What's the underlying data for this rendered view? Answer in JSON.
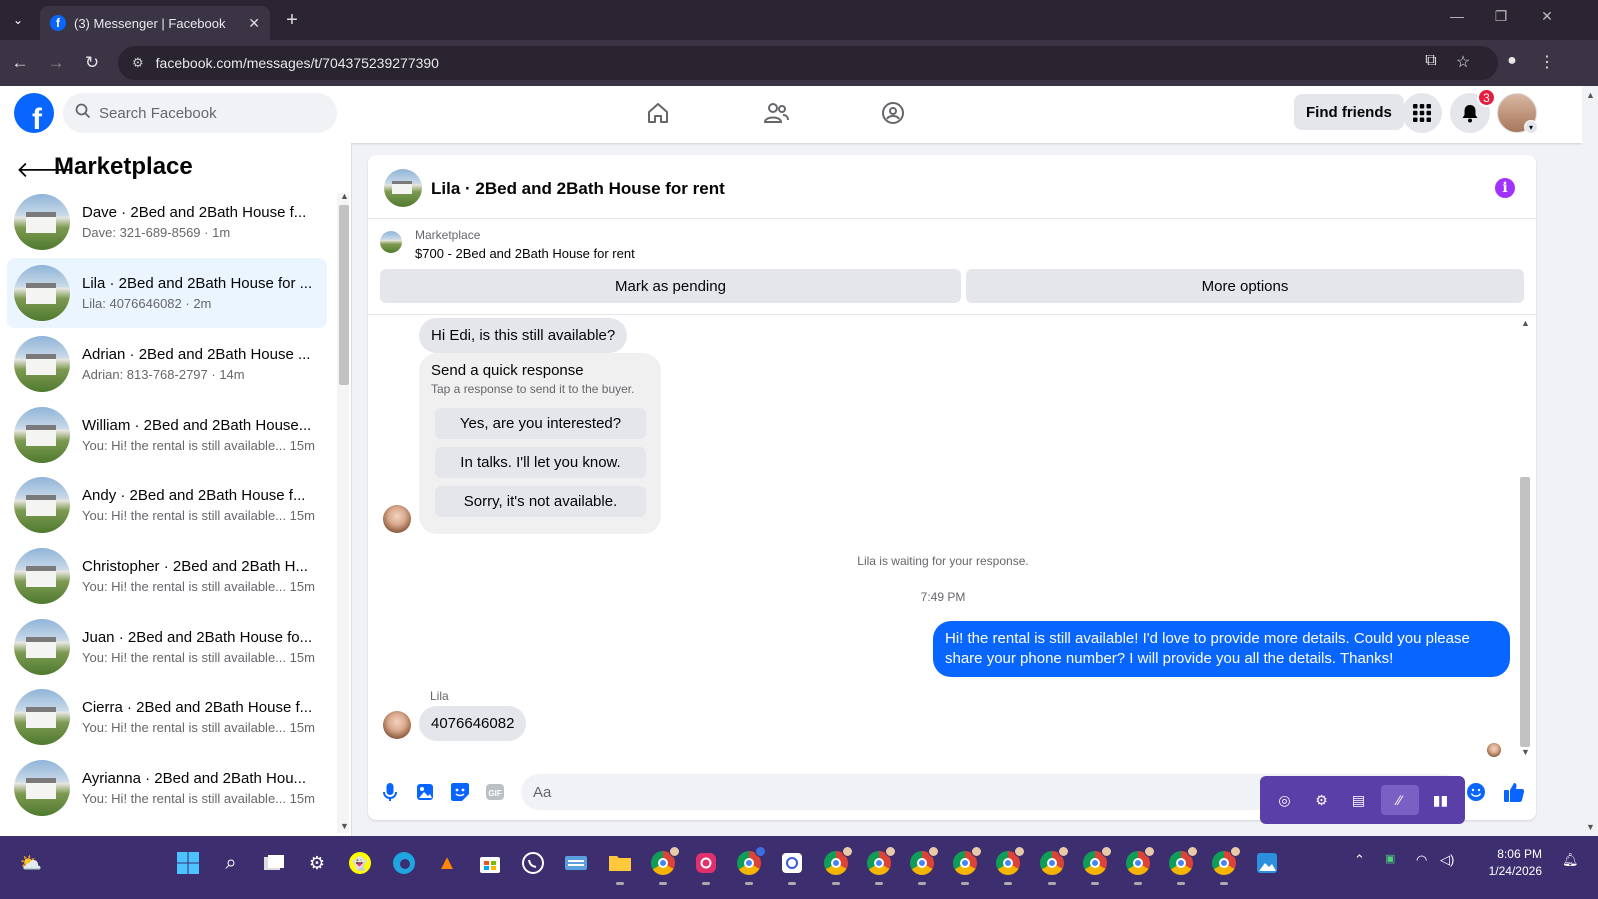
{
  "browser": {
    "tab_title": "(3) Messenger | Facebook",
    "url": "facebook.com/messages/t/704375239277390"
  },
  "header": {
    "search_placeholder": "Search Facebook",
    "find_friends": "Find friends",
    "notification_count": "3",
    "brand_color": "#0866ff"
  },
  "sidebar": {
    "title": "Marketplace",
    "conversations": [
      {
        "name": "Dave · 2Bed and 2Bath House f...",
        "preview": "Dave: 321-689-8569 · 1m"
      },
      {
        "name": "Lila · 2Bed and 2Bath House for ...",
        "preview": "Lila: 4076646082 · 2m",
        "active": true
      },
      {
        "name": "Adrian · 2Bed and 2Bath House ...",
        "preview": "Adrian: 813-768-2797 · 14m"
      },
      {
        "name": "William · 2Bed and 2Bath House...",
        "preview": "You: Hi! the rental is still available... 15m"
      },
      {
        "name": "Andy · 2Bed and 2Bath House f...",
        "preview": "You: Hi! the rental is still available... 15m"
      },
      {
        "name": "Christopher · 2Bed and 2Bath H...",
        "preview": "You: Hi! the rental is still available... 15m"
      },
      {
        "name": "Juan · 2Bed and 2Bath House fo...",
        "preview": "You: Hi! the rental is still available... 15m"
      },
      {
        "name": "Cierra · 2Bed and 2Bath House f...",
        "preview": "You: Hi! the rental is still available... 15m"
      },
      {
        "name": "Ayrianna · 2Bed and 2Bath Hou...",
        "preview": "You: Hi! the rental is still available... 15m"
      }
    ]
  },
  "chat": {
    "title": "Lila · 2Bed and 2Bath House for rent",
    "listing_label": "Marketplace",
    "listing_price": "$700 - 2Bed and 2Bath House for rent",
    "mark_pending": "Mark as pending",
    "more_options": "More options",
    "first_message": "Hi Edi, is this still available?",
    "quick_response_title": "Send a quick response",
    "quick_response_sub": "Tap a response to send it to the buyer.",
    "quick_replies": [
      "Yes, are you interested?",
      "In talks. I'll let you know.",
      "Sorry, it's not available."
    ],
    "waiting_note": "Lila is waiting for your response.",
    "timestamp": "7:49 PM",
    "outgoing_message": "Hi! the rental is still available! I'd love to provide more details. Could you please share your phone number? I will provide you all the details. Thanks!",
    "sender_label": "Lila",
    "reply_message": "4076646082",
    "composer_placeholder": "Aa",
    "outgoing_color": "#0866ff"
  },
  "taskbar": {
    "time": "8:06 PM",
    "date": "1/24/2026"
  }
}
